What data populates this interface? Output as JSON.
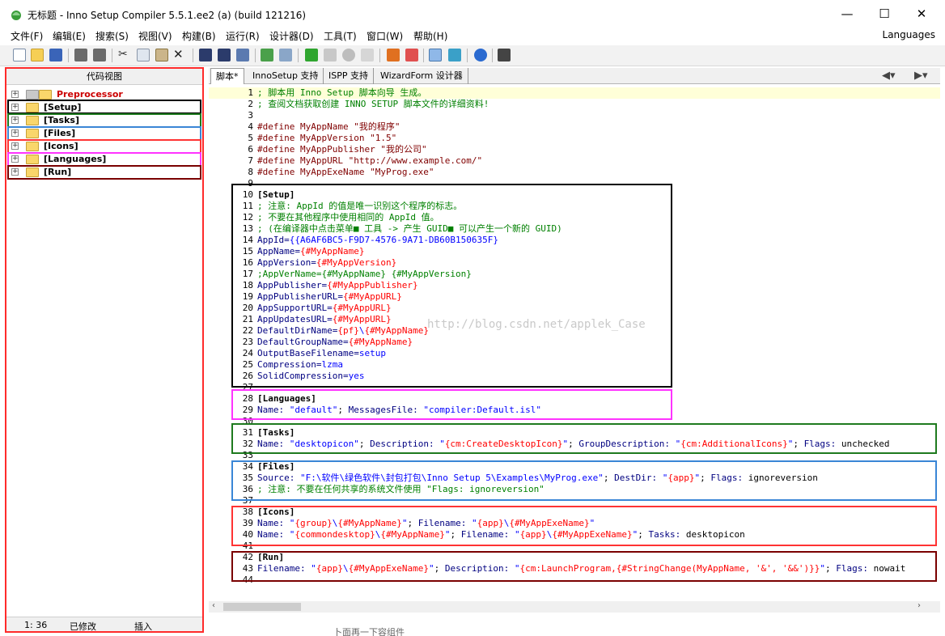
{
  "window": {
    "title": "无标题 - Inno Setup Compiler 5.5.1.ee2 (a) (build 121216)",
    "minimize": "—",
    "maximize": "☐",
    "close": "✕"
  },
  "menu": {
    "items": [
      "文件(F)",
      "编辑(E)",
      "搜索(S)",
      "视图(V)",
      "构建(B)",
      "运行(R)",
      "设计器(D)",
      "工具(T)",
      "窗口(W)",
      "帮助(H)"
    ],
    "right_label": "Languages"
  },
  "toolbar": {
    "icons": [
      "new-file-icon",
      "open-folder-icon",
      "save-icon",
      "undo-icon",
      "redo-icon",
      "cut-icon",
      "copy-icon",
      "paste-icon",
      "delete-icon",
      "find-icon",
      "find-next-icon",
      "replace-icon",
      "compile-icon",
      "stop-compile-icon",
      "run-icon",
      "pause-icon",
      "stop-icon",
      "step-icon",
      "wizard-icon",
      "wizard-alt-icon",
      "code-tree-icon",
      "refresh-icon",
      "help-icon",
      "options-icon"
    ]
  },
  "code_tree": {
    "title": "代码视图",
    "items": [
      {
        "label": "Preprocessor",
        "color": "#cc0000"
      },
      {
        "label": "[Setup]",
        "box_color": "#000000"
      },
      {
        "label": "[Tasks]",
        "box_color": "#1e7a1e"
      },
      {
        "label": "[Files]",
        "box_color": "#3a86d6"
      },
      {
        "label": "[Icons]",
        "box_color": "#ff3333"
      },
      {
        "label": "[Languages]",
        "box_color": "#ff33ff"
      },
      {
        "label": "[Run]",
        "box_color": "#7a0000"
      }
    ],
    "status": {
      "position": "1:  36",
      "modified": "已修改",
      "mode": "插入"
    }
  },
  "tabs": [
    "脚本*",
    "InnoSetup 支持",
    "ISPP 支持",
    "WizardForm 设计器"
  ],
  "editor": {
    "watermark": "http://blog.csdn.net/applek_Case",
    "lines": [
      [
        {
          "t": "; 脚本用 Inno Setup 脚本向导 生成。",
          "c": "cm"
        }
      ],
      [
        {
          "t": "; 查阅文档获取创建 INNO SETUP 脚本文件的详细资料!",
          "c": "cm"
        }
      ],
      [],
      [
        {
          "t": "#define ",
          "c": "pp"
        },
        {
          "t": "MyAppName ",
          "c": "pp"
        },
        {
          "t": "\"我的程序\"",
          "c": "pp"
        }
      ],
      [
        {
          "t": "#define ",
          "c": "pp"
        },
        {
          "t": "MyAppVersion ",
          "c": "pp"
        },
        {
          "t": "\"1.5\"",
          "c": "pp"
        }
      ],
      [
        {
          "t": "#define ",
          "c": "pp"
        },
        {
          "t": "MyAppPublisher ",
          "c": "pp"
        },
        {
          "t": "\"我的公司\"",
          "c": "pp"
        }
      ],
      [
        {
          "t": "#define ",
          "c": "pp"
        },
        {
          "t": "MyAppURL ",
          "c": "pp"
        },
        {
          "t": "\"http://www.example.com/\"",
          "c": "pp"
        }
      ],
      [
        {
          "t": "#define ",
          "c": "pp"
        },
        {
          "t": "MyAppExeName ",
          "c": "pp"
        },
        {
          "t": "\"MyProg.exe\"",
          "c": "pp"
        }
      ],
      [],
      [
        {
          "t": "[Setup]",
          "c": "sec"
        }
      ],
      [
        {
          "t": "; 注意: AppId 的值是唯一识别这个程序的标志。",
          "c": "cm"
        }
      ],
      [
        {
          "t": "; 不要在其他程序中使用相同的 AppId 值。",
          "c": "cm"
        }
      ],
      [
        {
          "t": "; (在编译器中点击菜单■ 工具 -> 产生 GUID■ 可以产生一个新的 GUID)",
          "c": "cm"
        }
      ],
      [
        {
          "t": "AppId=",
          "c": "key"
        },
        {
          "t": "{{A6AF6BC5-F9D7-4576-9A71-DB60B150635F}",
          "c": "val"
        }
      ],
      [
        {
          "t": "AppName=",
          "c": "key"
        },
        {
          "t": "{#MyAppName}",
          "c": "const"
        }
      ],
      [
        {
          "t": "AppVersion=",
          "c": "key"
        },
        {
          "t": "{#MyAppVersion}",
          "c": "const"
        }
      ],
      [
        {
          "t": ";AppVerName={#MyAppName} {#MyAppVersion}",
          "c": "cm"
        }
      ],
      [
        {
          "t": "AppPublisher=",
          "c": "key"
        },
        {
          "t": "{#MyAppPublisher}",
          "c": "const"
        }
      ],
      [
        {
          "t": "AppPublisherURL=",
          "c": "key"
        },
        {
          "t": "{#MyAppURL}",
          "c": "const"
        }
      ],
      [
        {
          "t": "AppSupportURL=",
          "c": "key"
        },
        {
          "t": "{#MyAppURL}",
          "c": "const"
        }
      ],
      [
        {
          "t": "AppUpdatesURL=",
          "c": "key"
        },
        {
          "t": "{#MyAppURL}",
          "c": "const"
        }
      ],
      [
        {
          "t": "DefaultDirName=",
          "c": "key"
        },
        {
          "t": "{pf}",
          "c": "const"
        },
        {
          "t": "\\",
          "c": "val"
        },
        {
          "t": "{#MyAppName}",
          "c": "const"
        }
      ],
      [
        {
          "t": "DefaultGroupName=",
          "c": "key"
        },
        {
          "t": "{#MyAppName}",
          "c": "const"
        }
      ],
      [
        {
          "t": "OutputBaseFilename=",
          "c": "key"
        },
        {
          "t": "setup",
          "c": "val"
        }
      ],
      [
        {
          "t": "Compression=",
          "c": "key"
        },
        {
          "t": "lzma",
          "c": "val"
        }
      ],
      [
        {
          "t": "SolidCompression=",
          "c": "key"
        },
        {
          "t": "yes",
          "c": "val"
        }
      ],
      [],
      [
        {
          "t": "[Languages]",
          "c": "sec"
        }
      ],
      [
        {
          "t": "Name: ",
          "c": "key"
        },
        {
          "t": "\"default\"",
          "c": "val"
        },
        {
          "t": "; ",
          "c": "plain"
        },
        {
          "t": "MessagesFile: ",
          "c": "key"
        },
        {
          "t": "\"compiler:Default.isl\"",
          "c": "val"
        }
      ],
      [],
      [
        {
          "t": "[Tasks]",
          "c": "sec"
        }
      ],
      [
        {
          "t": "Name: ",
          "c": "key"
        },
        {
          "t": "\"desktopicon\"",
          "c": "val"
        },
        {
          "t": "; ",
          "c": "plain"
        },
        {
          "t": "Description: ",
          "c": "key"
        },
        {
          "t": "\"",
          "c": "val"
        },
        {
          "t": "{cm:CreateDesktopIcon}",
          "c": "const"
        },
        {
          "t": "\"",
          "c": "val"
        },
        {
          "t": "; ",
          "c": "plain"
        },
        {
          "t": "GroupDescription: ",
          "c": "key"
        },
        {
          "t": "\"",
          "c": "val"
        },
        {
          "t": "{cm:AdditionalIcons}",
          "c": "const"
        },
        {
          "t": "\"",
          "c": "val"
        },
        {
          "t": "; ",
          "c": "plain"
        },
        {
          "t": "Flags: ",
          "c": "key"
        },
        {
          "t": "unchecked",
          "c": "plain"
        }
      ],
      [],
      [
        {
          "t": "[Files]",
          "c": "sec"
        }
      ],
      [
        {
          "t": "Source: ",
          "c": "key"
        },
        {
          "t": "\"F:\\软件\\绿色软件\\封包打包\\Inno Setup 5\\Examples\\MyProg.exe\"",
          "c": "val"
        },
        {
          "t": "; ",
          "c": "plain"
        },
        {
          "t": "DestDir: ",
          "c": "key"
        },
        {
          "t": "\"",
          "c": "val"
        },
        {
          "t": "{app}",
          "c": "const"
        },
        {
          "t": "\"",
          "c": "val"
        },
        {
          "t": "; ",
          "c": "plain"
        },
        {
          "t": "Flags: ",
          "c": "key"
        },
        {
          "t": "ignoreversion",
          "c": "plain"
        }
      ],
      [
        {
          "t": "; 注意: 不要在任何共享的系统文件使用 \"Flags: ignoreversion\"",
          "c": "cm"
        }
      ],
      [],
      [
        {
          "t": "[Icons]",
          "c": "sec"
        }
      ],
      [
        {
          "t": "Name: ",
          "c": "key"
        },
        {
          "t": "\"",
          "c": "val"
        },
        {
          "t": "{group}",
          "c": "const"
        },
        {
          "t": "\\",
          "c": "val"
        },
        {
          "t": "{#MyAppName}",
          "c": "const"
        },
        {
          "t": "\"",
          "c": "val"
        },
        {
          "t": "; ",
          "c": "plain"
        },
        {
          "t": "Filename: ",
          "c": "key"
        },
        {
          "t": "\"",
          "c": "val"
        },
        {
          "t": "{app}",
          "c": "const"
        },
        {
          "t": "\\",
          "c": "val"
        },
        {
          "t": "{#MyAppExeName}",
          "c": "const"
        },
        {
          "t": "\"",
          "c": "val"
        }
      ],
      [
        {
          "t": "Name: ",
          "c": "key"
        },
        {
          "t": "\"",
          "c": "val"
        },
        {
          "t": "{commondesktop}",
          "c": "const"
        },
        {
          "t": "\\",
          "c": "val"
        },
        {
          "t": "{#MyAppName}",
          "c": "const"
        },
        {
          "t": "\"",
          "c": "val"
        },
        {
          "t": "; ",
          "c": "plain"
        },
        {
          "t": "Filename: ",
          "c": "key"
        },
        {
          "t": "\"",
          "c": "val"
        },
        {
          "t": "{app}",
          "c": "const"
        },
        {
          "t": "\\",
          "c": "val"
        },
        {
          "t": "{#MyAppExeName}",
          "c": "const"
        },
        {
          "t": "\"",
          "c": "val"
        },
        {
          "t": "; ",
          "c": "plain"
        },
        {
          "t": "Tasks: ",
          "c": "key"
        },
        {
          "t": "desktopicon",
          "c": "plain"
        }
      ],
      [],
      [
        {
          "t": "[Run]",
          "c": "sec"
        }
      ],
      [
        {
          "t": "Filename: ",
          "c": "key"
        },
        {
          "t": "\"",
          "c": "val"
        },
        {
          "t": "{app}",
          "c": "const"
        },
        {
          "t": "\\",
          "c": "val"
        },
        {
          "t": "{#MyAppExeName}",
          "c": "const"
        },
        {
          "t": "\"",
          "c": "val"
        },
        {
          "t": "; ",
          "c": "plain"
        },
        {
          "t": "Description: ",
          "c": "key"
        },
        {
          "t": "\"",
          "c": "val"
        },
        {
          "t": "{cm:LaunchProgram,{#StringChange(MyAppName, '&', '&&')}}",
          "c": "const"
        },
        {
          "t": "\"",
          "c": "val"
        },
        {
          "t": "; ",
          "c": "plain"
        },
        {
          "t": "Flags: ",
          "c": "key"
        },
        {
          "t": "nowait",
          "c": "plain"
        }
      ],
      []
    ],
    "section_boxes": [
      {
        "name": "setup",
        "color": "#000000"
      },
      {
        "name": "languages",
        "color": "#ff33ff"
      },
      {
        "name": "tasks",
        "color": "#1e7a1e"
      },
      {
        "name": "files",
        "color": "#3a86d6"
      },
      {
        "name": "icons",
        "color": "#ff3333"
      },
      {
        "name": "run",
        "color": "#7a0000"
      }
    ]
  },
  "below_editor": {
    "text": "卜面再一下容组件"
  }
}
